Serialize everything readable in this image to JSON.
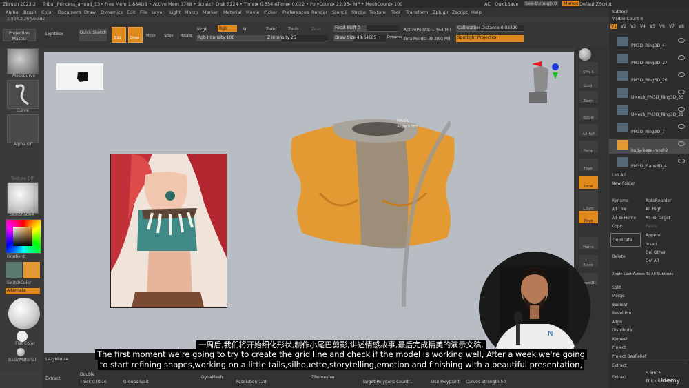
{
  "titlebar": {
    "app": "ZBrush 2023.2",
    "doc": "Tribal_Princess_aHead_13",
    "stats": "• Free Mem 1.884GB • Active Mem 3748 • Scratch Disk 5224 • Timer▸ 0.354 ATime▸ 0.022 • PolyCount▸ 22.964 MP • MeshCount▸ 100",
    "ac": "AC",
    "quicksave": "QuickSave",
    "seethrough": "See-through  0",
    "menus": "Menus",
    "script": "DefaultZScript"
  },
  "menubar": [
    "Alpha",
    "Brush",
    "Color",
    "Document",
    "Draw",
    "Dynamics",
    "Edit",
    "File",
    "Layer",
    "Light",
    "Macro",
    "Marker",
    "Material",
    "Movie",
    "Picker",
    "Preferences",
    "Render",
    "Stencil",
    "Stroke",
    "Texture",
    "Tool",
    "Transform",
    "Zplugin",
    "Zscript",
    "Help"
  ],
  "coords": "1.934,2.264,0.582",
  "toolbar": {
    "projection_master": "Projection Master",
    "lightbox": "LightBox",
    "quick_sketch": "Quick Sketch",
    "edit": "Edit",
    "draw": "Draw",
    "move": "Move",
    "scale": "Scale",
    "rotate": "Rotate",
    "mrgb": "Mrgb",
    "rgb": "Rgb",
    "m": "M",
    "rgb_intensity": "Rgb Intensity 100",
    "zadd": "Zadd",
    "zsub": "Zsub",
    "zcut": "Zcut",
    "z_intensity": "Z Intensity 25",
    "focal_shift": "Focal Shift 0",
    "draw_size": "Draw Size 48.64685",
    "dynamic": "Dynamic",
    "active_points": "ActivePoints: 1.464 Mil",
    "total_points": "TotalPoints: 38.090 Mil",
    "calibration": "Calibration Distance 0.08329",
    "spotlight": "Spotlight Projection"
  },
  "leftpanel": {
    "maskcurve": "MaskCurve",
    "curve": "Curve",
    "alpha_off": "Alpha Off",
    "texture_off": "Texture Off",
    "material": "SkinShade4",
    "gradient": "Gradient",
    "switchcolor": "SwitchColor",
    "alternate": "Alternate",
    "flat_color": "Flat Color",
    "basic_material": "BasicMaterial"
  },
  "canvas": {
    "mask_text": "MASK",
    "mask_sub": "Angle 0.583"
  },
  "rightshelf": [
    "SPix 3",
    "Scroll",
    "Zoom",
    "Actual",
    "AAHalf",
    "Persp",
    "Floor",
    "Local",
    "Dynamic",
    "L.Sym",
    "Qxyz",
    "Frame",
    "Move",
    "Zoom3D"
  ],
  "subtool": {
    "title": "Subtool",
    "visible_count": "Visible Count 8",
    "versions": [
      "V1",
      "V2",
      "V3",
      "V4",
      "V5",
      "V6",
      "V7",
      "V8"
    ],
    "items": [
      "PM3D_Ring3D_4",
      "PM3D_Ring3D_27",
      "PM3D_Ring3D_26",
      "UMesh_PM3D_Ring3D_30",
      "UMesh_PM3D_Ring3D_31",
      "PM3D_Ring3D_7",
      "body-base-mesh2",
      "PM3D_Plane3D_4"
    ],
    "list_all": "List All",
    "new_folder": "New Folder",
    "rename": "Rename",
    "autoreorder": "AutoReorder",
    "all_low": "All Low",
    "all_high": "All High",
    "all_to_home": "All To Home",
    "all_to_target": "All To Target",
    "copy": "Copy",
    "paste": "Paste",
    "duplicate": "Duplicate",
    "append": "Append",
    "insert": "Insert",
    "delete": "Delete",
    "del_other": "Del Other",
    "del_all": "Del All",
    "apply_last": "Apply Last Action To All Subtools",
    "split": "Split",
    "merge": "Merge",
    "boolean": "Boolean",
    "bevel_pro": "Bevel Pro",
    "align": "Align",
    "distribute": "Distribute",
    "remesh": "Remesh",
    "project": "Project",
    "project_basrelief": "Project BasRelief",
    "extract": "Extract",
    "s_smt": "S Smt 5",
    "thick": "Thick 0.0016"
  },
  "bottombar": {
    "lazymouse": "LazyMouse",
    "extract": "Extract",
    "double": "Double",
    "thick": "Thick 0.0016",
    "groups_split": "Groups Split",
    "dynamesh": "DynaMesh",
    "resolution": "Resolution 128",
    "zremesher": "ZRemesher",
    "target_polygons": "Target Polygons Count 1",
    "use_polypaint": "Use Polypaint",
    "curves_strength": "Curves Strength 50"
  },
  "subtitles": {
    "chinese": "一周后,我们将开始细化形状,制作小尾巴剪影,讲述情感故事,最后完成精美的演示文稿,",
    "line1": "The first moment we're going to try to create the grid line and check if the model is working well, After a week we're going",
    "line2": "to start refining shapes,working on a little tails,silhouette,storytelling,emotion and finishing with a beautiful presentation,"
  },
  "watermark": "Udemy",
  "colors": {
    "accent_orange": "#e08a1e",
    "shirt_orange": "#e39a32",
    "canvas_bg": "#b8bcc3",
    "panel": "#3a3a3a"
  }
}
